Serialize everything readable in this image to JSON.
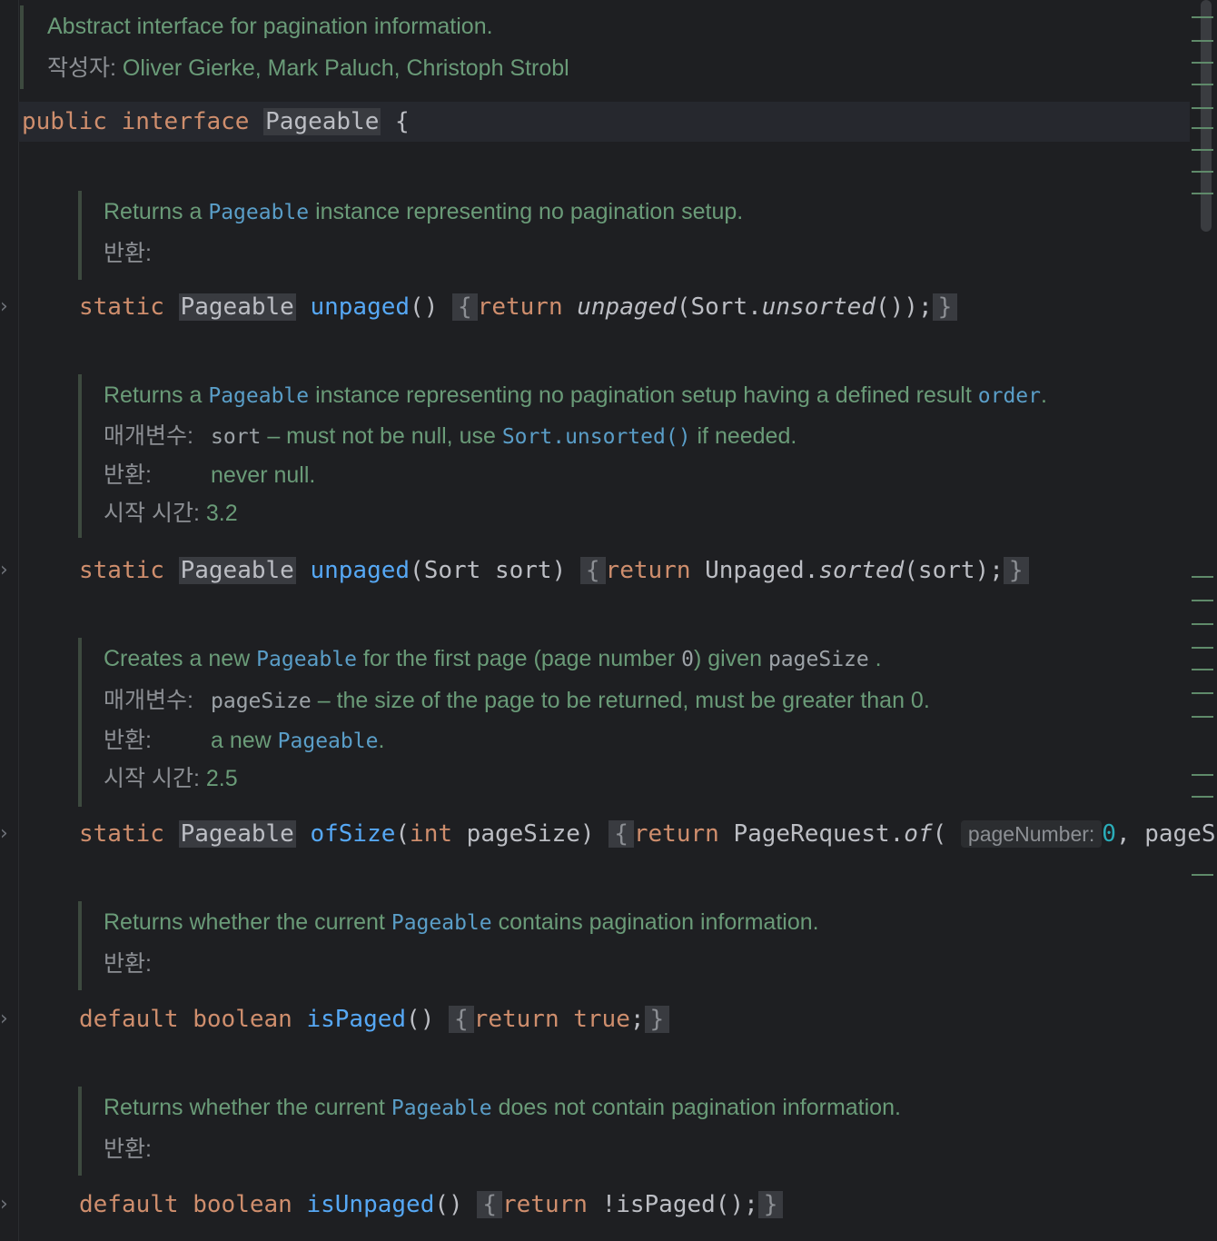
{
  "class_doc": {
    "description": "Abstract interface for pagination information.",
    "author_label": "작성자:",
    "authors": "Oliver Gierke, Mark Paluch, Christoph Strobl"
  },
  "class_decl": {
    "kw_public": "public",
    "kw_interface": "interface",
    "name": "Pageable",
    "open_brace": "{"
  },
  "method1": {
    "doc_pre": "Returns a",
    "doc_ref": "Pageable",
    "doc_post": "instance representing no pagination setup.",
    "returns_label": "반환:",
    "kw": "static",
    "type": "Pageable",
    "name": "unpaged",
    "params": "()",
    "body_return": "return",
    "body_call": "unpaged",
    "body_rest_a": "(Sort.",
    "body_call2": "unsorted",
    "body_rest_b": "());"
  },
  "method2": {
    "doc_pre": "Returns a",
    "doc_ref": "Pageable",
    "doc_mid": "instance representing no pagination setup having a defined result",
    "doc_ref2": "order",
    "doc_end": ".",
    "params_label": "매개변수:",
    "param_name": "sort",
    "param_desc_a": " – must not be null, use",
    "param_ref": "Sort.unsorted()",
    "param_desc_b": "if needed.",
    "returns_label": "반환:",
    "returns_value": "never null.",
    "since_label": "시작 시간:",
    "since_value": "3.2",
    "kw": "static",
    "type": "Pageable",
    "name": "unpaged",
    "params": "(Sort sort)",
    "body_return": "return",
    "body_a": "Unpaged.",
    "body_call": "sorted",
    "body_b": "(sort);"
  },
  "method3": {
    "doc_pre": "Creates a new",
    "doc_ref": "Pageable",
    "doc_mid": "for the first page (page number",
    "doc_zero": "0",
    "doc_mid2": ") given",
    "doc_param": "pageSize",
    "doc_end": " .",
    "params_label": "매개변수:",
    "param_name": "pageSize",
    "param_desc": " – the size of the page to be returned, must be greater than 0.",
    "returns_label": "반환:",
    "returns_pre": "a new",
    "returns_ref": "Pageable",
    "returns_end": ".",
    "since_label": "시작 시간:",
    "since_value": "2.5",
    "kw": "static",
    "type": "Pageable",
    "name": "ofSize",
    "params_open": "(",
    "param_type": "int",
    "params_rest": " pageSize)",
    "body_return": "return",
    "body_a": "PageRequest.",
    "body_call": "of",
    "body_paren": "(",
    "hint": "pageNumber:",
    "hint_value": "0",
    "body_tail": ", pageS"
  },
  "method4": {
    "doc_pre": "Returns whether the current",
    "doc_ref": "Pageable",
    "doc_post": "contains pagination information.",
    "returns_label": "반환:",
    "kw": "default",
    "type": "boolean",
    "name": "isPaged",
    "params": "()",
    "body_return": "return",
    "body_value": "true",
    "body_end": ";"
  },
  "method5": {
    "doc_pre": "Returns whether the current",
    "doc_ref": "Pageable",
    "doc_post": "does not contain pagination information.",
    "returns_label": "반환:",
    "kw": "default",
    "type": "boolean",
    "name": "isUnpaged",
    "params": "()",
    "body_return": "return",
    "body_rest": "!isPaged();"
  },
  "braces": {
    "open": "{",
    "close": "}"
  },
  "icons": {
    "fold": "chevron-right-icon"
  },
  "colors": {
    "background": "#1e1f22",
    "keyword": "#cf8e6d",
    "method": "#56a8f5",
    "doc": "#6a9b78",
    "doc_ref": "#5a9ec8"
  }
}
